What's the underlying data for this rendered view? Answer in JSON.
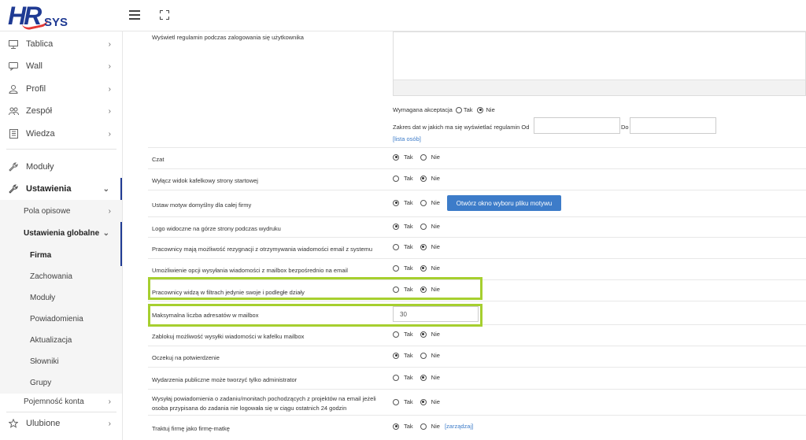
{
  "app": {
    "logo_hr": "HR",
    "logo_sys": "SYS"
  },
  "sidebar": {
    "items": [
      {
        "label": "Tablica",
        "icon": "monitor-icon"
      },
      {
        "label": "Wall",
        "icon": "chat-icon"
      },
      {
        "label": "Profil",
        "icon": "user-icon"
      },
      {
        "label": "Zespół",
        "icon": "team-icon"
      },
      {
        "label": "Wiedza",
        "icon": "book-icon"
      },
      {
        "label": "Moduły",
        "icon": "wrench-icon"
      },
      {
        "label": "Ustawienia",
        "icon": "wrench-icon"
      },
      {
        "label": "Ulubione",
        "icon": "star-icon"
      }
    ],
    "sub": {
      "pola": "Pola opisowe",
      "globalne": "Ustawienia globalne",
      "firma": "Firma",
      "zachowania": "Zachowania",
      "moduly": "Moduły",
      "powiadomienia": "Powiadomienia",
      "aktualizacja": "Aktualizacja",
      "slowniki": "Słowniki",
      "grupy": "Grupy",
      "pojemnosc": "Pojemność konta"
    }
  },
  "main": {
    "regulamin_label": "Wyświetl regulamin podczas zalogowania się użytkownika",
    "wymagana": "Wymagana akceptacja",
    "zakres": "Zakres dat w jakich ma się wyświetlać regulamin Od",
    "do": "Do",
    "lista_osob": "[lista osób]",
    "tak": "Tak",
    "nie": "Nie",
    "rows": [
      {
        "label": "Czat"
      },
      {
        "label": "Wyłącz widok kafelkowy strony startowej"
      },
      {
        "label": "Ustaw motyw domyślny dla całej firmy"
      },
      {
        "label": "Logo widoczne na górze strony podczas wydruku"
      },
      {
        "label": "Pracownicy mają możliwość rezygnacji z otrzymywania wiadomości email z systemu"
      },
      {
        "label": "Umożliwienie opcji wysyłania wiadomości z mailbox bezpośrednio na email"
      },
      {
        "label": "Pracownicy widzą w filtrach jedynie swoje i podległe działy"
      },
      {
        "label": "Maksymalna liczba adresatów w mailbox"
      },
      {
        "label": "Zablokuj możliwość wysyłki wiadomości w kafelku mailbox"
      },
      {
        "label": "Oczekuj na potwierdzenie"
      },
      {
        "label": "Wydarzenia publiczne może tworzyć tylko administrator"
      },
      {
        "label": "Wysyłaj powiadomienia o zadaniu/monitach pochodzących z projektów na email jeżeli"
      },
      {
        "label": "osoba przypisana do zadania nie logowała się w ciągu ostatnich 24 godzin"
      },
      {
        "label": "Traktuj firmę jako firmę-matkę"
      }
    ],
    "theme_button": "Otwórz okno wyboru pliku motywu",
    "max_recipients": "30",
    "zarzadzaj": "[zarządzaj]"
  },
  "colors": {
    "accent": "#3d7cc9",
    "highlight": "#a6cf2f",
    "brand": "#1f3a93"
  }
}
